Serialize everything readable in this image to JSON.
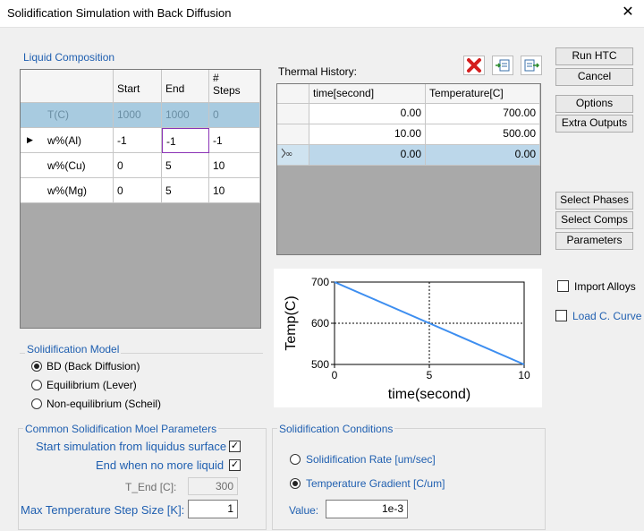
{
  "window": {
    "title": "Solidification Simulation with Back Diffusion",
    "close_glyph": "✕"
  },
  "buttons": {
    "run": "Run HTC",
    "cancel": "Cancel",
    "options": "Options",
    "extra": "Extra Outputs",
    "select_phases": "Select Phases",
    "select_comps": "Select Comps",
    "parameters": "Parameters"
  },
  "checks": {
    "import_alloys": "Import Alloys",
    "load_curve": "Load C. Curve"
  },
  "liquid": {
    "title": "Liquid Composition",
    "headers": [
      "Start",
      "End",
      "#\nSteps"
    ],
    "rows": [
      {
        "label": "T(C)",
        "start": "1000",
        "end": "1000",
        "steps": "0"
      },
      {
        "label": "w%(Al)",
        "start": "-1",
        "end": "-1",
        "steps": "-1"
      },
      {
        "label": "w%(Cu)",
        "start": "0",
        "end": "5",
        "steps": "10"
      },
      {
        "label": "w%(Mg)",
        "start": "0",
        "end": "5",
        "steps": "10"
      }
    ]
  },
  "thermal": {
    "title": "Thermal History:",
    "headers": [
      "time[second]",
      "Temperature[C]"
    ],
    "rows": [
      {
        "time": "0.00",
        "temp": "700.00"
      },
      {
        "time": "10.00",
        "temp": "500.00"
      },
      {
        "time": "0.00",
        "temp": "0.00"
      }
    ]
  },
  "chart_data": {
    "type": "line",
    "x": [
      0,
      10
    ],
    "y": [
      700,
      500
    ],
    "xlabel": "time(second)",
    "ylabel": "Temp(C)",
    "xlim": [
      0,
      10
    ],
    "ylim": [
      500,
      700
    ],
    "xticks": [
      "0",
      "5",
      "10"
    ],
    "yticks": [
      "500",
      "600",
      "700"
    ],
    "line_color": "#3d8ef0"
  },
  "model": {
    "title": "Solidification Model",
    "options": [
      "BD (Back Diffusion)",
      "Equilibrium (Lever)",
      "Non-equilibrium (Scheil)"
    ],
    "selected": 0
  },
  "common": {
    "title": "Common Solidification Moel Parameters",
    "start_liquidus": "Start simulation from liquidus surface",
    "end_no_liquid": "End when no more liquid",
    "t_end_label": "T_End [C]:",
    "t_end_value": "300",
    "max_step_label": "Max Temperature Step Size [K]:",
    "max_step_value": "1"
  },
  "conditions": {
    "title": "Solidification Conditions",
    "rate": "Solidification Rate [um/sec]",
    "gradient": "Temperature Gradient [C/um]",
    "value_label": "Value:",
    "value": "1e-3"
  }
}
